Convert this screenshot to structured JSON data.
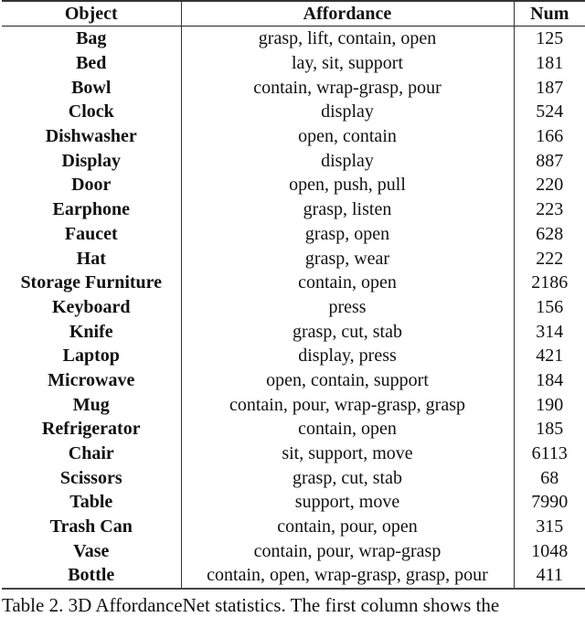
{
  "table": {
    "headers": {
      "object": "Object",
      "affordance": "Affordance",
      "num": "Num"
    },
    "rows": [
      {
        "object": "Bag",
        "affordance": "grasp, lift, contain, open",
        "num": "125"
      },
      {
        "object": "Bed",
        "affordance": "lay, sit, support",
        "num": "181"
      },
      {
        "object": "Bowl",
        "affordance": "contain, wrap-grasp, pour",
        "num": "187"
      },
      {
        "object": "Clock",
        "affordance": "display",
        "num": "524"
      },
      {
        "object": "Dishwasher",
        "affordance": "open, contain",
        "num": "166"
      },
      {
        "object": "Display",
        "affordance": "display",
        "num": "887"
      },
      {
        "object": "Door",
        "affordance": "open, push, pull",
        "num": "220"
      },
      {
        "object": "Earphone",
        "affordance": "grasp, listen",
        "num": "223"
      },
      {
        "object": "Faucet",
        "affordance": "grasp, open",
        "num": "628"
      },
      {
        "object": "Hat",
        "affordance": "grasp, wear",
        "num": "222"
      },
      {
        "object": "Storage Furniture",
        "affordance": "contain, open",
        "num": "2186"
      },
      {
        "object": "Keyboard",
        "affordance": "press",
        "num": "156"
      },
      {
        "object": "Knife",
        "affordance": "grasp, cut, stab",
        "num": "314"
      },
      {
        "object": "Laptop",
        "affordance": "display, press",
        "num": "421"
      },
      {
        "object": "Microwave",
        "affordance": "open, contain, support",
        "num": "184"
      },
      {
        "object": "Mug",
        "affordance": "contain, pour, wrap-grasp, grasp",
        "num": "190"
      },
      {
        "object": "Refrigerator",
        "affordance": "contain, open",
        "num": "185"
      },
      {
        "object": "Chair",
        "affordance": "sit, support, move",
        "num": "6113"
      },
      {
        "object": "Scissors",
        "affordance": "grasp, cut, stab",
        "num": "68"
      },
      {
        "object": "Table",
        "affordance": "support, move",
        "num": "7990"
      },
      {
        "object": "Trash Can",
        "affordance": "contain, pour, open",
        "num": "315"
      },
      {
        "object": "Vase",
        "affordance": "contain, pour, wrap-grasp",
        "num": "1048"
      },
      {
        "object": "Bottle",
        "affordance": "contain, open, wrap-grasp, grasp, pour",
        "num": "411"
      }
    ]
  },
  "caption": "Table 2. 3D AffordanceNet statistics. The first column shows the"
}
